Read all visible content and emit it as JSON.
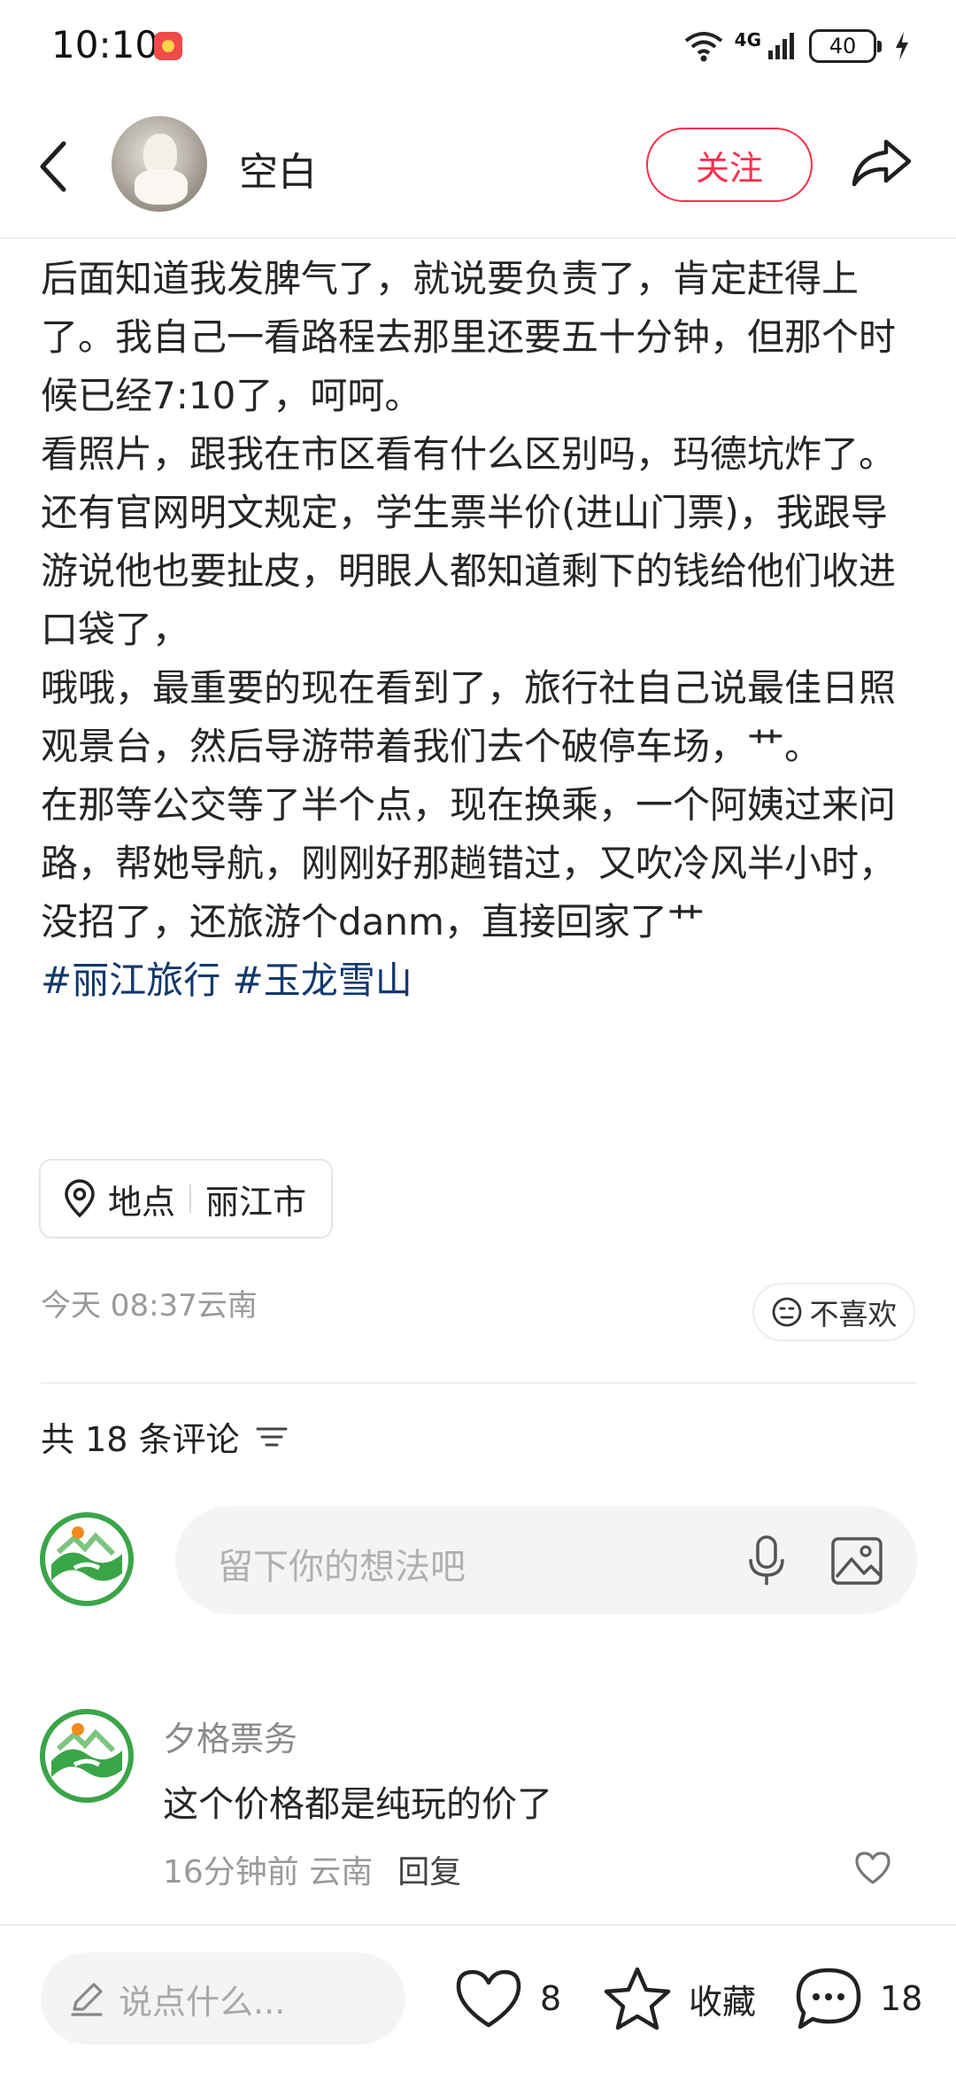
{
  "status_bar": {
    "time": "10:10",
    "network": "4G",
    "battery": "40"
  },
  "header": {
    "author_name": "空白",
    "follow_label": "关注"
  },
  "post": {
    "paragraphs": [
      "后面知道我发脾气了，就说要负责了，肯定赶得上了。我自己一看路程去那里还要五十分钟，但那个时候已经7:10了，呵呵。",
      "看照片，跟我在市区看有什么区别吗，玛德坑炸了。",
      "还有官网明文规定，学生票半价(进山门票)，我跟导游说他也要扯皮，明眼人都知道剩下的钱给他们收进口袋了，",
      "哦哦，最重要的现在看到了，旅行社自己说最佳日照观景台，然后导游带着我们去个破停车场，艹。",
      "在那等公交等了半个点，现在换乘，一个阿姨过来问路，帮她导航，刚刚好那趟错过，又吹冷风半小时，没招了，还旅游个danm，直接回家了艹"
    ],
    "tags": "#丽江旅行 #玉龙雪山",
    "location_label": "地点",
    "location_value": "丽江市",
    "time": "今天 08:37云南",
    "dislike_label": "不喜欢"
  },
  "comments": {
    "count_label": "共 18 条评论",
    "composer_placeholder": "留下你的想法吧",
    "items": [
      {
        "user": "夕格票务",
        "text": "这个价格都是纯玩的价了",
        "time": "16分钟前",
        "region": "云南",
        "reply_label": "回复"
      }
    ]
  },
  "bottom_bar": {
    "input_placeholder": "说点什么...",
    "likes": "8",
    "collect_label": "收藏",
    "comments": "18"
  },
  "colors": {
    "accent": "#ff2e4d",
    "tag": "#13386c",
    "logo_green": "#3aa548",
    "logo_orange": "#f08a1c"
  }
}
